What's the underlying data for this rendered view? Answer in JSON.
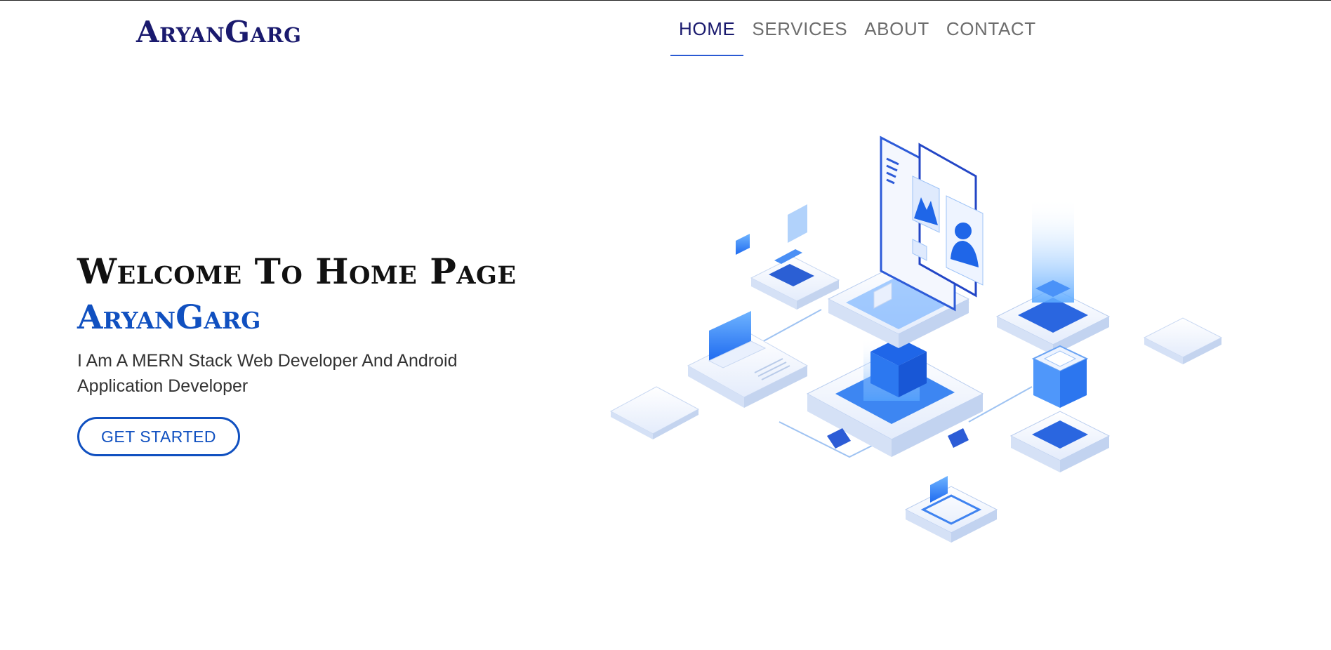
{
  "navbar": {
    "brand": "AryanGarg",
    "links": [
      {
        "label": "Home",
        "active": true
      },
      {
        "label": "Services",
        "active": false
      },
      {
        "label": "About",
        "active": false
      },
      {
        "label": "Contact",
        "active": false
      }
    ]
  },
  "hero": {
    "title": "Welcome To Home Page",
    "name": "AryanGarg",
    "subtitle": "I Am A MERN Stack Web Developer And Android Application Developer",
    "cta_label": "Get Started"
  },
  "illustration": {
    "icon": "isometric-tech-network-illustration"
  },
  "colors": {
    "brand": "#1a1a6e",
    "accent": "#1050c0",
    "active_underline": "#2a5ad3",
    "nav_text": "#6d6d6d"
  }
}
